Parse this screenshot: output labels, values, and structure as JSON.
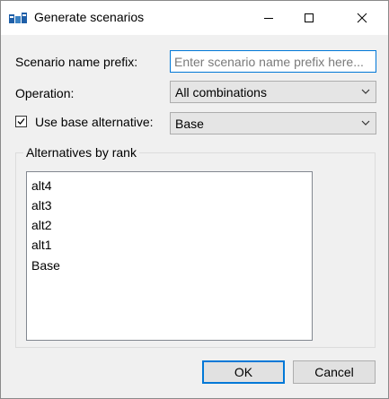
{
  "window": {
    "title": "Generate scenarios",
    "controls": [
      "minimize-icon",
      "maximize-icon",
      "close-icon"
    ]
  },
  "form": {
    "prefix_label": "Scenario name prefix:",
    "prefix_value": "",
    "prefix_placeholder": "Enter scenario name prefix here...",
    "operation_label": "Operation:",
    "operation_value": "All combinations",
    "use_base_label": "Use base alternative:",
    "use_base_checked": true,
    "base_value": "Base"
  },
  "alternatives": {
    "group_label": "Alternatives by rank",
    "items": [
      "alt4",
      "alt3",
      "alt2",
      "alt1",
      "Base"
    ]
  },
  "buttons": {
    "ok_label": "OK",
    "cancel_label": "Cancel"
  },
  "colors": {
    "accent": "#0078d7",
    "dialog_bg": "#f0f0f0"
  }
}
